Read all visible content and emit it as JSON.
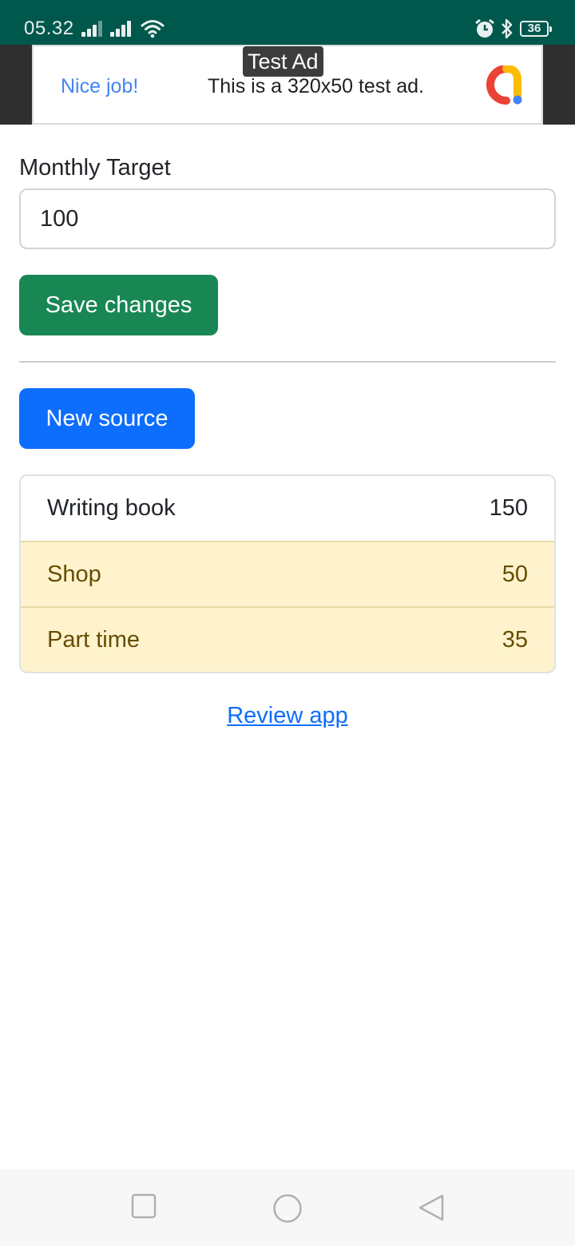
{
  "status_bar": {
    "time": "05.32",
    "battery": "36",
    "icons": [
      "signal-icon",
      "signal-icon",
      "wifi-icon",
      "alarm-icon",
      "bluetooth-icon",
      "battery-icon"
    ]
  },
  "ad": {
    "label": "Test Ad",
    "headline": "Nice job!",
    "text": "This is a 320x50 test ad.",
    "logo_icon": "admob-logo-icon"
  },
  "target": {
    "label": "Monthly Target",
    "value": "100"
  },
  "buttons": {
    "save": "Save changes",
    "new_source": "New source"
  },
  "sources": [
    {
      "name": "Writing book",
      "amount": "150",
      "style": "plain"
    },
    {
      "name": "Shop",
      "amount": "50",
      "style": "warning"
    },
    {
      "name": "Part time",
      "amount": "35",
      "style": "warning"
    }
  ],
  "review_link": "Review app",
  "colors": {
    "status_bar": "#00574b",
    "save_button": "#198754",
    "new_button": "#0d6efd",
    "warning_row": "#fff3cd",
    "link": "#0d6efd"
  },
  "nav": {
    "icons": [
      "recents-square-icon",
      "home-circle-icon",
      "back-triangle-icon"
    ]
  }
}
